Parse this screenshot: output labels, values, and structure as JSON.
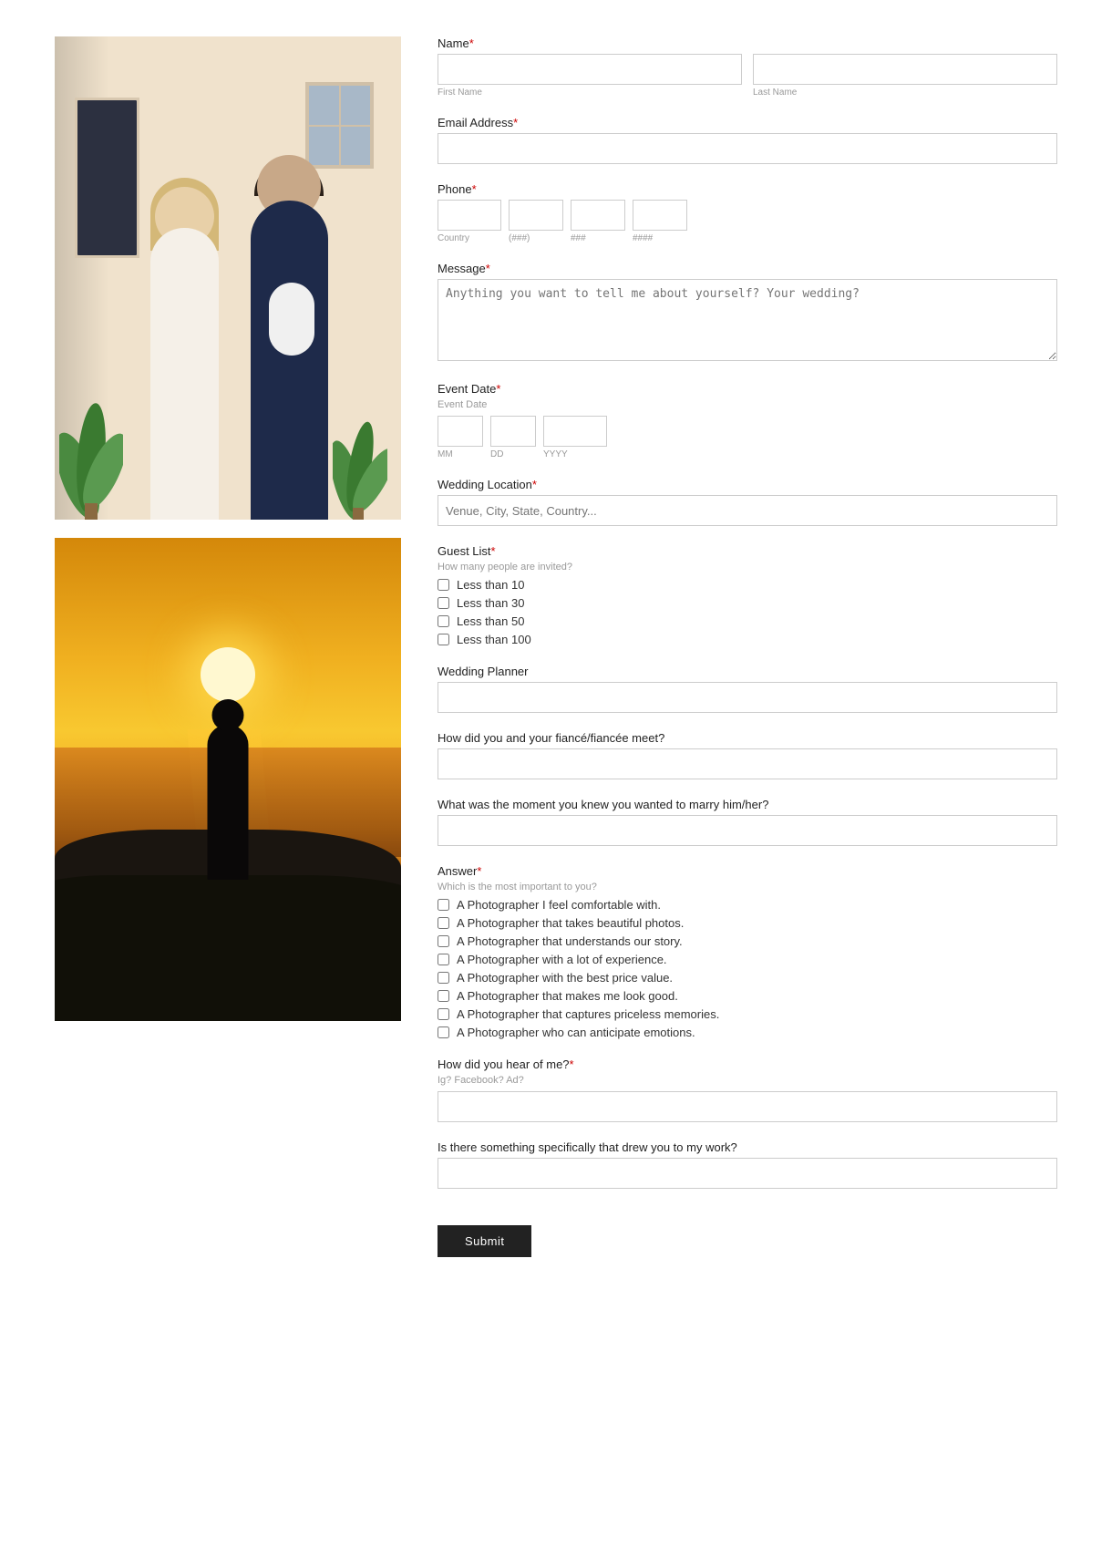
{
  "form": {
    "name_label": "Name",
    "name_required": "*",
    "first_name_label": "First Name",
    "last_name_label": "Last Name",
    "email_label": "Email Address",
    "email_required": "*",
    "phone_label": "Phone",
    "phone_required": "*",
    "phone_country_label": "Country",
    "phone_area_label": "(###)",
    "phone_mid_label": "###",
    "phone_end_label": "####",
    "message_label": "Message",
    "message_required": "*",
    "message_placeholder": "Anything you want to tell me about yourself? Your wedding?",
    "event_date_label": "Event Date",
    "event_date_required": "*",
    "event_date_sublabel": "Event Date",
    "date_mm_label": "MM",
    "date_dd_label": "DD",
    "date_yyyy_label": "YYYY",
    "wedding_location_label": "Wedding Location",
    "wedding_location_required": "*",
    "wedding_location_placeholder": "Venue, City, State, Country...",
    "guest_list_label": "Guest List",
    "guest_list_required": "*",
    "guest_list_sublabel": "How many people are invited?",
    "guest_options": [
      "Less than 10",
      "Less than 30",
      "Less than 50",
      "Less than 100"
    ],
    "wedding_planner_label": "Wedding Planner",
    "fiance_meet_label": "How did you and your fiancé/fiancée meet?",
    "marry_moment_label": "What was the moment you knew you wanted to marry him/her?",
    "answer_label": "Answer",
    "answer_required": "*",
    "answer_sublabel": "Which is the most important to you?",
    "answer_options": [
      "A Photographer I feel comfortable with.",
      "A Photographer that takes beautiful photos.",
      "A Photographer that understands our story.",
      "A Photographer with a lot of experience.",
      "A Photographer with the best price value.",
      "A Photographer that makes me look good.",
      "A Photographer that captures priceless memories.",
      "A Photographer who can anticipate emotions."
    ],
    "hear_label": "How did you hear of me?",
    "hear_required": "*",
    "hear_sublabel": "Ig? Facebook? Ad?",
    "drew_label": "Is there something specifically that drew you to my work?",
    "submit_label": "Submit"
  }
}
